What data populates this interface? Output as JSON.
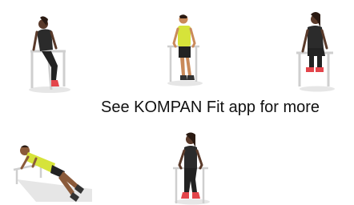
{
  "caption": "See KOMPAN Fit app for more",
  "figures": [
    {
      "name": "exercise-figure-1",
      "exercise": "bench-dip",
      "shirt": "#2b2b2b",
      "skin": "#5a3a2a",
      "pants": "#222222",
      "shoes": "#e3454b"
    },
    {
      "name": "exercise-figure-2",
      "exercise": "bar-dip",
      "shirt": "#d6e33a",
      "skin": "#c98a5a",
      "pants": "#222222",
      "shoes": "#333333"
    },
    {
      "name": "exercise-figure-3",
      "exercise": "seated-leg-raise",
      "shirt": "#2b2b2b",
      "skin": "#5a3a2a",
      "pants": "#222222",
      "shoes": "#e3454b"
    },
    {
      "name": "exercise-figure-4",
      "exercise": "incline-push-up",
      "shirt": "#d6e33a",
      "skin": "#8a5a3a",
      "pants": "#222222",
      "shoes": "#333333"
    },
    {
      "name": "exercise-figure-5",
      "exercise": "bar-dip",
      "shirt": "#2b2b2b",
      "skin": "#5a3a2a",
      "pants": "#222222",
      "shoes": "#e3454b"
    }
  ]
}
